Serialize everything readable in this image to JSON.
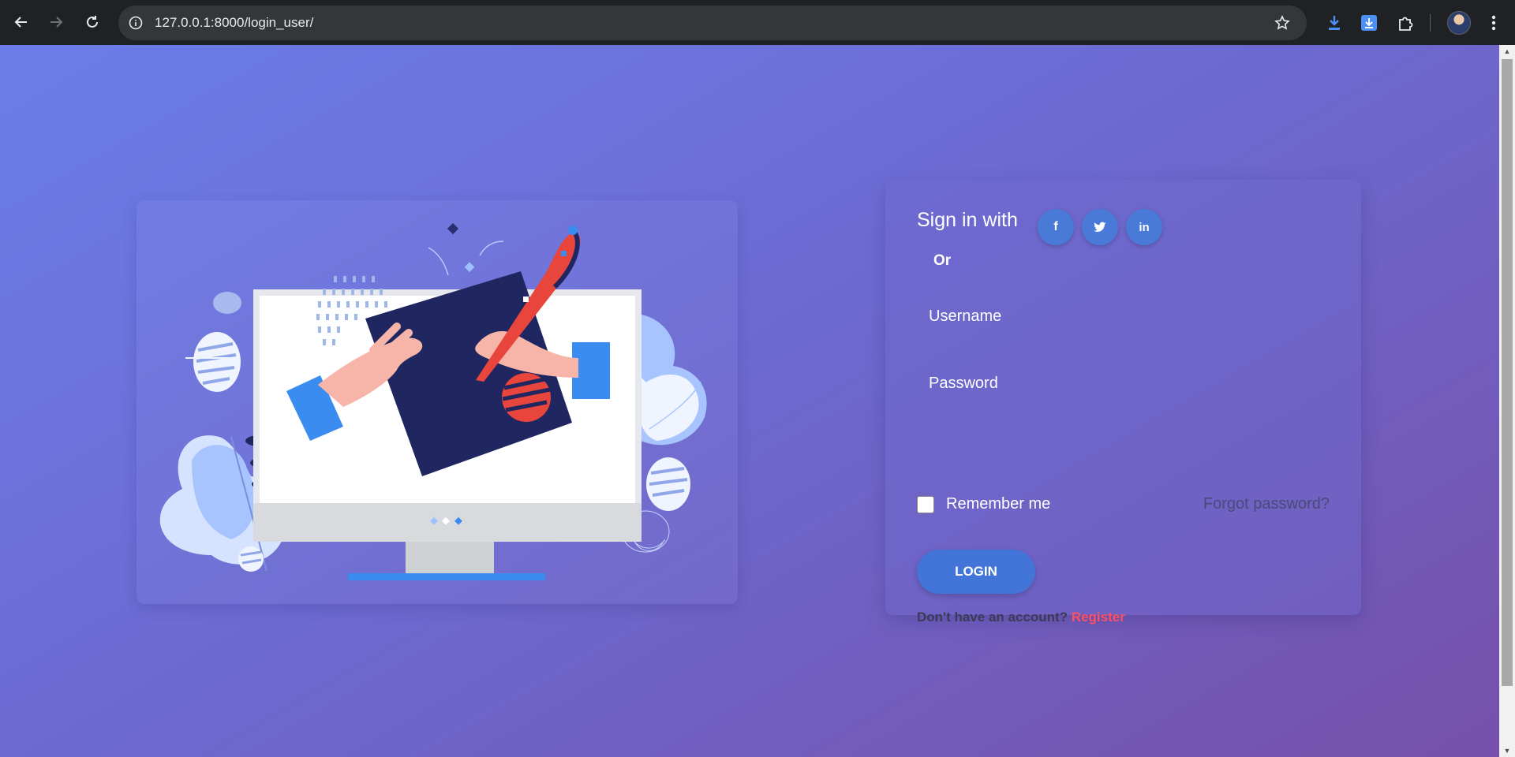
{
  "browser": {
    "url": "127.0.0.1:8000/login_user/",
    "back_icon": "arrow-left-icon",
    "forward_icon": "arrow-right-icon",
    "reload_icon": "reload-icon",
    "site_info_icon": "info-icon",
    "bookmark_icon": "star-icon",
    "toolbar_icons": [
      "download-icon",
      "download-box-icon",
      "extensions-puzzle-icon",
      "profile-avatar",
      "more-vert-icon"
    ]
  },
  "login": {
    "sign_in_title": "Sign in with",
    "social_buttons": [
      {
        "label": "f",
        "icon": "facebook-icon"
      },
      {
        "label": "t",
        "icon": "twitter-icon"
      },
      {
        "label": "in",
        "icon": "linkedin-icon"
      }
    ],
    "or_label": "Or",
    "username_placeholder": "Username",
    "password_placeholder": "Password",
    "remember_label": "Remember me",
    "forgot_label": "Forgot password?",
    "login_button": "LOGIN",
    "no_account_text": "Don't have an account?",
    "register_label": "Register"
  },
  "illustration": {
    "icon": "monitor-drawing-illustration"
  },
  "colors": {
    "page_gradient_start": "#6b7de9",
    "page_gradient_end": "#7650aa",
    "button_blue": "#4374d8",
    "register_red": "#ff4f62",
    "monitor_blue_stand": "#3b8cf0",
    "tablet_navy": "#1f2660",
    "pen_red": "#e8453c",
    "hand_peach": "#f6b5a8"
  }
}
